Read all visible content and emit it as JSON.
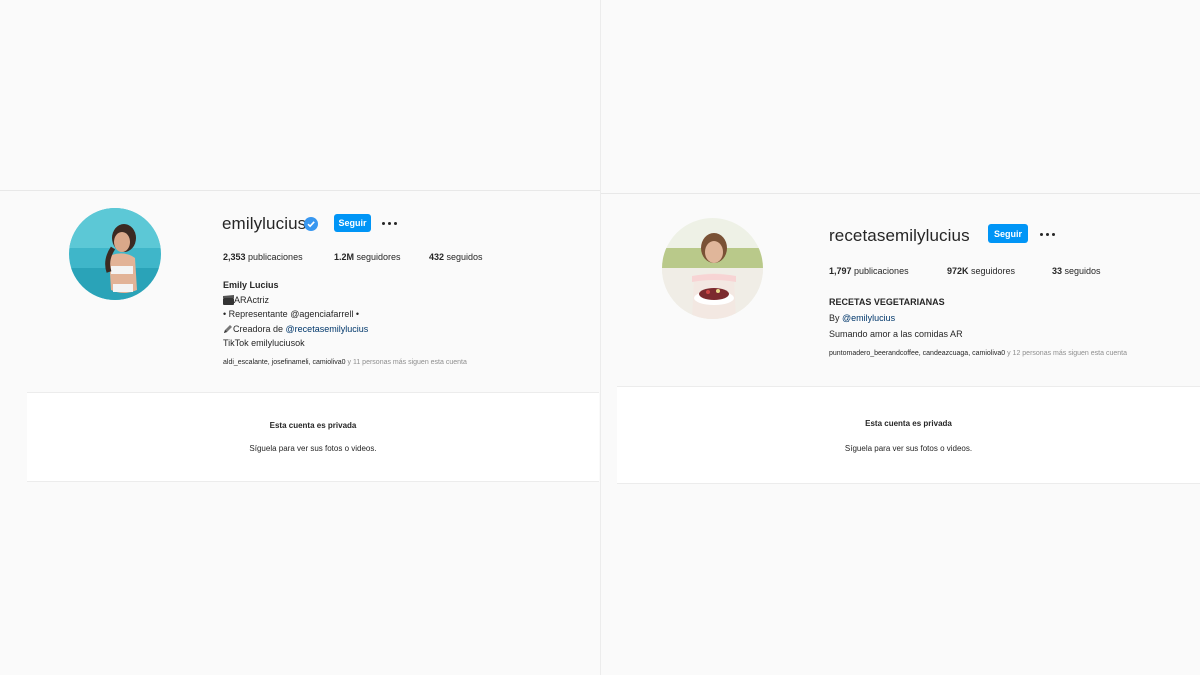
{
  "left_profile": {
    "username": "emilylucius",
    "verified": true,
    "follow_label": "Seguir",
    "stats": {
      "posts_value": "2,353",
      "posts_label": " publicaciones",
      "followers_value": "1.2M",
      "followers_label": " seguidores",
      "following_value": "432",
      "following_label": " seguidos"
    },
    "bio": {
      "name": "Emily Lucius",
      "line1": "ARActriz",
      "line2": "• Representante @agenciafarrell •",
      "line3_prefix": "Creadora de ",
      "line3_link": "@recetasemilylucius",
      "line4": "TikTok emilyluciusok"
    },
    "followed_by_users": "aldi_escalante, josefinameli, camioliva0",
    "followed_by_rest": " y 11 personas más siguen esta cuenta",
    "private_title": "Esta cuenta es privada",
    "private_sub": "Síguela para ver sus fotos o videos."
  },
  "right_profile": {
    "username": "recetasemilylucius",
    "follow_label": "Seguir",
    "stats": {
      "posts_value": "1,797",
      "posts_label": " publicaciones",
      "followers_value": "972K",
      "followers_label": " seguidores",
      "following_value": "33",
      "following_label": " seguidos"
    },
    "bio": {
      "name": "RECETAS VEGETARIANAS",
      "line1_prefix": "By ",
      "line1_link": "@emilylucius",
      "line2": "Sumando amor a las comidas AR"
    },
    "followed_by_users": "puntomadero_beerandcoffee, candeazcuaga, camioliva0",
    "followed_by_rest": " y 12 personas más siguen esta cuenta",
    "private_title": "Esta cuenta es privada",
    "private_sub": "Síguela para ver sus fotos o videos."
  },
  "colors": {
    "background": "#fafafa",
    "follow_button": "#0095f6",
    "verified_badge": "#3897f0",
    "link": "#00376b"
  },
  "icons": [
    "verified-badge-icon",
    "more-options-icon",
    "clapper-icon",
    "pencil-icon"
  ]
}
